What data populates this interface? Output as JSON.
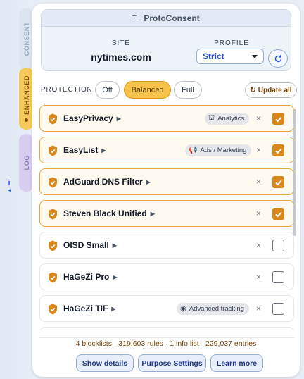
{
  "rail": {
    "info_icon": "i",
    "tabs": [
      {
        "label": "CONSENT"
      },
      {
        "label": "ENHANCED"
      },
      {
        "label": "LOG"
      }
    ]
  },
  "header": {
    "title": "ProtoConsent",
    "site_label": "SITE",
    "site_value": "nytimes.com",
    "profile_label": "PROFILE",
    "profile_value": "Strict"
  },
  "protection": {
    "label": "PROTECTION",
    "options": [
      "Off",
      "Balanced",
      "Full"
    ],
    "selected": "Balanced",
    "update_label": "Update all"
  },
  "lists": [
    {
      "name": "EasyPrivacy",
      "tag": "Analytics",
      "tag_icon": "analytics-icon",
      "checked": true
    },
    {
      "name": "EasyList",
      "tag": "Ads / Marketing",
      "tag_icon": "megaphone-icon",
      "checked": true
    },
    {
      "name": "AdGuard DNS Filter",
      "tag": "",
      "checked": true
    },
    {
      "name": "Steven Black Unified",
      "tag": "",
      "checked": true
    },
    {
      "name": "OISD Small",
      "tag": "",
      "checked": false
    },
    {
      "name": "HaGeZi Pro",
      "tag": "",
      "checked": false
    },
    {
      "name": "HaGeZi TIF",
      "tag": "Advanced tracking",
      "tag_icon": "eye-icon",
      "checked": false
    }
  ],
  "stats": "4 blocklists · 319,603 rules · 1 info list · 229,037 entries",
  "footer": {
    "details": "Show details",
    "purpose": "Purpose Settings",
    "learn": "Learn more"
  },
  "colors": {
    "accent": "#f6c24a",
    "checked": "#d9861a",
    "link": "#1d4ed8"
  }
}
